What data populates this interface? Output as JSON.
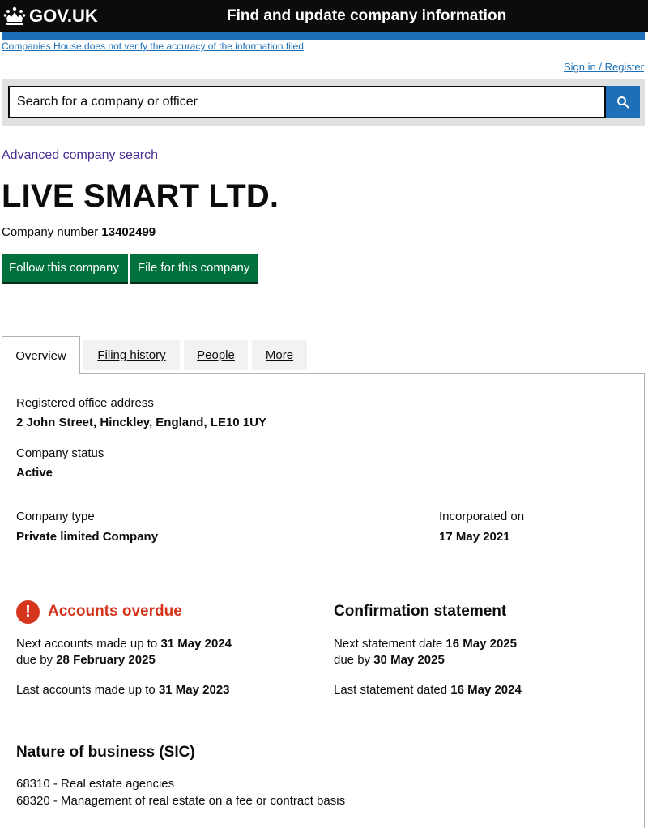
{
  "header": {
    "logo_text": "GOV.UK",
    "service_name": "Find and update company information",
    "disclaimer": "Companies House does not verify the accuracy of the information filed",
    "signin": "Sign in / Register"
  },
  "search": {
    "placeholder": "Search for a company or officer",
    "button_icon": "search-icon"
  },
  "advanced_search": "Advanced company search",
  "company": {
    "name": "LIVE SMART LTD.",
    "number_label": "Company number",
    "number": "13402499"
  },
  "buttons": {
    "follow": "Follow this company",
    "file": "File for this company"
  },
  "tabs": [
    {
      "label": "Overview",
      "active": true
    },
    {
      "label": "Filing history",
      "active": false
    },
    {
      "label": "People",
      "active": false
    },
    {
      "label": "More",
      "active": false
    }
  ],
  "overview": {
    "address_label": "Registered office address",
    "address": "2 John Street, Hinckley, England, LE10 1UY",
    "status_label": "Company status",
    "status": "Active",
    "type_label": "Company type",
    "type": "Private limited Company",
    "incorporated_label": "Incorporated on",
    "incorporated": "17 May 2021"
  },
  "accounts": {
    "title": "Accounts overdue",
    "icon": "warning-icon",
    "icon_glyph": "!",
    "next_prefix": "Next accounts made up to",
    "next_date": "31 May 2024",
    "due_prefix": "due by",
    "due_date": "28 February 2025",
    "last_prefix": "Last accounts made up to",
    "last_date": "31 May 2023"
  },
  "confirmation": {
    "title": "Confirmation statement",
    "next_prefix": "Next statement date",
    "next_date": "16 May 2025",
    "due_prefix": "due by",
    "due_date": "30 May 2025",
    "last_prefix": "Last statement dated",
    "last_date": "16 May 2024"
  },
  "sic": {
    "title": "Nature of business (SIC)",
    "items": [
      "68310 - Real estate agencies",
      "68320 - Management of real estate on a fee or contract basis"
    ]
  },
  "colors": {
    "header_bg": "#0b0c0c",
    "brand_blue": "#1d70b8",
    "button_green": "#00703c",
    "error_red": "#d4351c",
    "visited_link": "#4c2c92"
  }
}
